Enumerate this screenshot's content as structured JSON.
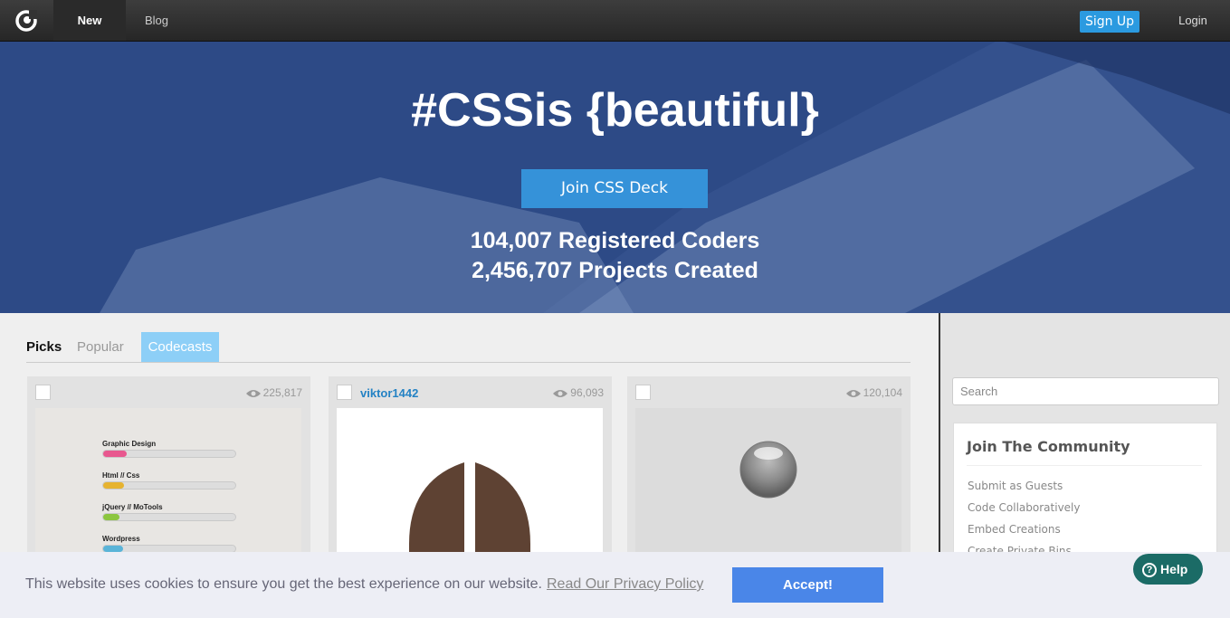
{
  "nav": {
    "new_label": "New",
    "blog_label": "Blog",
    "signup_label": "Sign Up",
    "login_label": "Login"
  },
  "hero": {
    "title": "#CSSis {beautiful}",
    "cta_label": "Join CSS Deck",
    "stat_coders": "104,007 Registered Coders",
    "stat_projects": "2,456,707 Projects Created"
  },
  "tabs": {
    "picks": "Picks",
    "popular": "Popular",
    "codecasts": "Codecasts"
  },
  "cards": [
    {
      "author": "",
      "views": "225,817",
      "skills": [
        {
          "label": "Graphic Design",
          "level": 0.18,
          "color": "#e8588f"
        },
        {
          "label": "Html // Css",
          "level": 0.16,
          "color": "#e6b330"
        },
        {
          "label": "jQuery // MoTools",
          "level": 0.12,
          "color": "#8cc63f"
        },
        {
          "label": "Wordpress",
          "level": 0.15,
          "color": "#5ab4d8"
        }
      ]
    },
    {
      "author": "viktor1442",
      "views": "96,093"
    },
    {
      "author": "",
      "views": "120,104"
    }
  ],
  "sidebar": {
    "search_placeholder": "Search",
    "community_title": "Join The Community",
    "community_items": [
      "Submit as Guests",
      "Code Collaboratively",
      "Embed Creations",
      "Create Private Bins"
    ]
  },
  "cookie": {
    "message": "This website uses cookies to ensure you get the best experience on our website.",
    "policy_link": "Read Our Privacy Policy",
    "accept_label": "Accept!"
  },
  "help": {
    "label": "Help"
  },
  "colors": {
    "accent": "#3592d9",
    "hero_bg": "#2c4884",
    "codecasts_tab": "#8dcff7",
    "accept_button": "#4a86e8",
    "help_button": "#1b6b66"
  }
}
